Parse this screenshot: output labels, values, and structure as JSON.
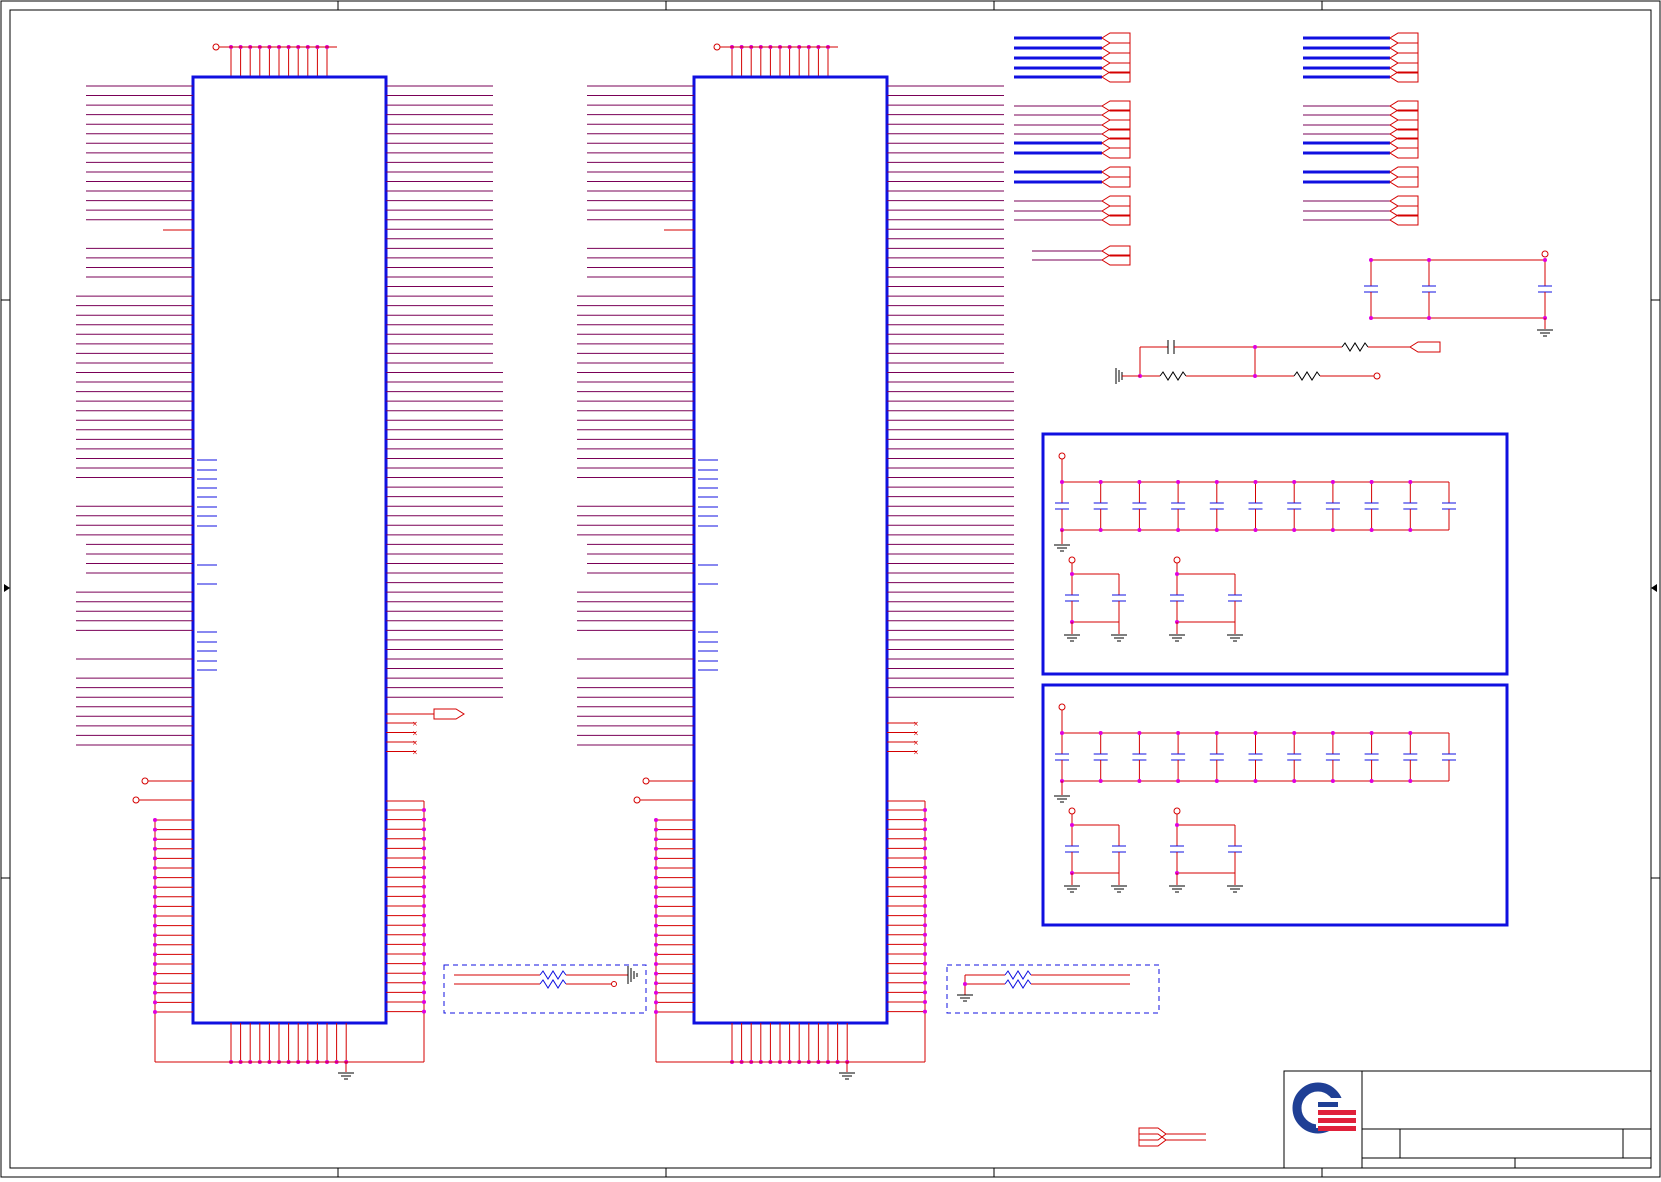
{
  "document": {
    "kind": "schematic",
    "title_block_text": [],
    "logo": "company-logo"
  },
  "colors": {
    "wire": "#d40000",
    "net_trace": "#7a0057",
    "part_outline": "#1010e0",
    "junction": "#e000e0",
    "frame": "#000000",
    "logo_blue": "#1f3f95",
    "logo_red": "#e0213a"
  },
  "components": {
    "ic_blocks": 2,
    "power_ports": "circle",
    "ground_symbols": "ground-icon",
    "off_page_connectors": "port-icon"
  }
}
